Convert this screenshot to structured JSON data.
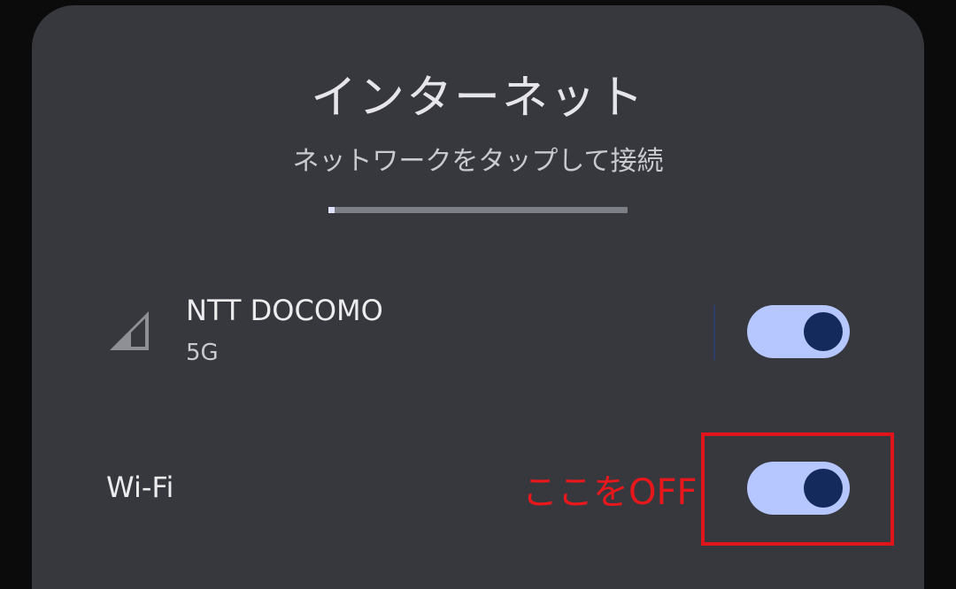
{
  "dialog": {
    "title": "インターネット",
    "subtitle": "ネットワークをタップして接続",
    "progress_fraction": 0.02
  },
  "mobile_network": {
    "name": "NTT DOCOMO",
    "type": "5G",
    "enabled": true,
    "icon": "cell-signal-icon"
  },
  "wifi": {
    "label": "Wi-Fi",
    "enabled": true
  },
  "annotation": {
    "text": "ここをOFF",
    "color": "#e8171c"
  },
  "colors": {
    "sheet_bg": "#37383d",
    "toggle_track_on": "#b6c6ff",
    "toggle_knob_on": "#142a5c"
  }
}
